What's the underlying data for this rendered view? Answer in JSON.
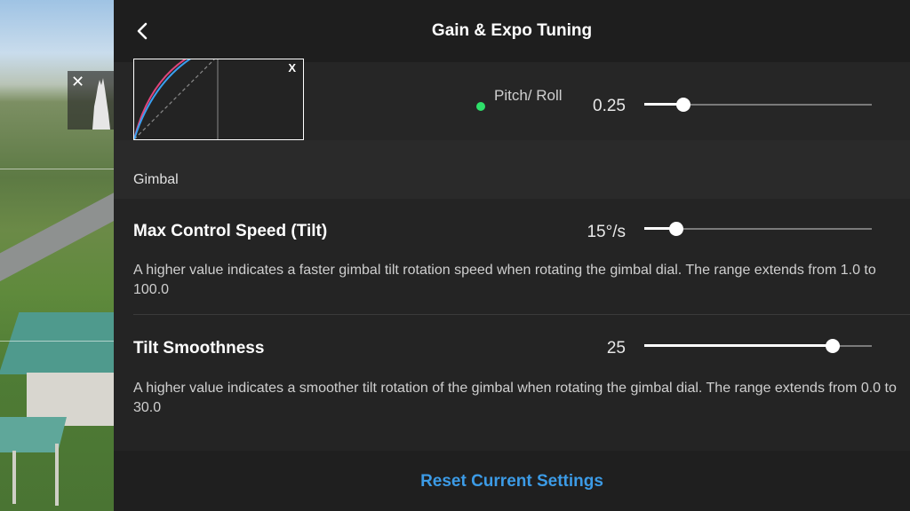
{
  "header": {
    "title": "Gain & Expo Tuning"
  },
  "expo": {
    "graph_axis_label": "X",
    "pitch_roll_label": "Pitch/ Roll",
    "pitch_roll_value": "0.25",
    "pitch_roll_slider_fraction": 0.17
  },
  "section": {
    "title": "Gimbal"
  },
  "settings": [
    {
      "label": "Max Control Speed (Tilt)",
      "value": "15°/s",
      "slider_fraction": 0.14,
      "description": "A higher value indicates a faster gimbal tilt rotation speed when rotating the gimbal dial. The range extends from 1.0 to 100.0"
    },
    {
      "label": "Tilt Smoothness",
      "value": "25",
      "slider_fraction": 0.83,
      "description": "A higher value indicates a smoother tilt rotation of the gimbal when rotating the gimbal dial. The range extends from 0.0 to 30.0"
    }
  ],
  "footer": {
    "reset_label": "Reset Current Settings"
  },
  "colors": {
    "accent": "#3c9be6",
    "status_dot": "#2ee06a"
  }
}
